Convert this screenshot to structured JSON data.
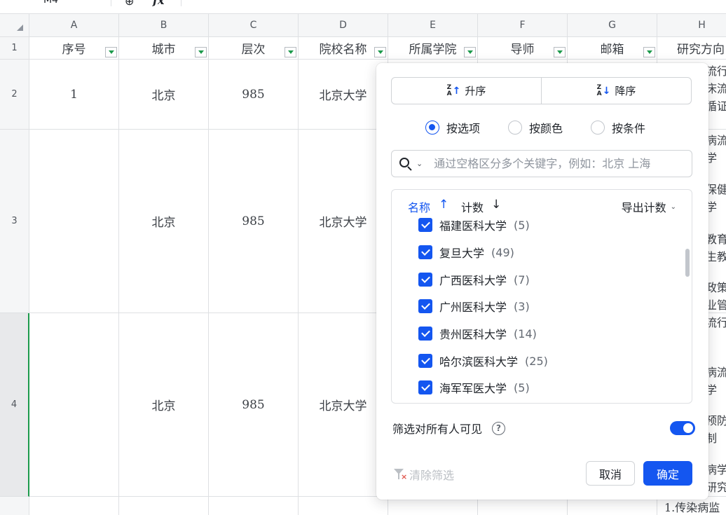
{
  "formula_bar": {
    "cell_ref": "M4",
    "zoom_glyph": "⊕",
    "fx_label": "fx"
  },
  "columns": [
    {
      "letter": "A",
      "header": "序号"
    },
    {
      "letter": "B",
      "header": "城市"
    },
    {
      "letter": "C",
      "header": "层次"
    },
    {
      "letter": "D",
      "header": "院校名称"
    },
    {
      "letter": "E",
      "header": "所属学院"
    },
    {
      "letter": "F",
      "header": "导师"
    },
    {
      "letter": "G",
      "header": "邮箱"
    },
    {
      "letter": "H",
      "header": "研究方向"
    }
  ],
  "rows": [
    {
      "num": "1"
    },
    {
      "num": "2",
      "cells": [
        "1",
        "北京",
        "985",
        "北京大学"
      ]
    },
    {
      "num": "3",
      "cells": [
        "",
        "北京",
        "985",
        "北京大学"
      ]
    },
    {
      "num": "4",
      "cells": [
        "",
        "北京",
        "985",
        "北京大学"
      ]
    }
  ],
  "h_column_fragments": [
    "流行",
    "床流",
    "循证",
    "病流",
    "学",
    "保健",
    "学",
    "教育",
    "生教",
    "政策",
    "业管",
    "流行",
    "病流",
    "学",
    "预防",
    "制",
    "病学",
    "研究",
    "1.传染病监"
  ],
  "filter_panel": {
    "sort_asc": "升序",
    "sort_desc": "降序",
    "modes": [
      {
        "label": "按选项",
        "checked": true
      },
      {
        "label": "按颜色",
        "checked": false
      },
      {
        "label": "按条件",
        "checked": false
      }
    ],
    "search_placeholder": "通过空格区分多个关键字，例如：北京 上海",
    "list_header": {
      "name": "名称",
      "name_arrow": "↑",
      "count": "计数",
      "count_arrow": "↓",
      "export": "导出计数"
    },
    "items": [
      {
        "name": "福建医科大学",
        "count": "(5)"
      },
      {
        "name": "复旦大学",
        "count": "(49)"
      },
      {
        "name": "广西医科大学",
        "count": "(7)"
      },
      {
        "name": "广州医科大学",
        "count": "(3)"
      },
      {
        "name": "贵州医科大学",
        "count": "(14)"
      },
      {
        "name": "哈尔滨医科大学",
        "count": "(25)"
      },
      {
        "name": "海军军医大学",
        "count": "(5)"
      }
    ],
    "visible_to_all": "筛选对所有人可见",
    "visible_toggle_on": true,
    "clear": "清除筛选",
    "cancel": "取消",
    "confirm": "确定"
  },
  "colors": {
    "accent": "#1456f0",
    "selection_green": "#1c9a4b"
  }
}
